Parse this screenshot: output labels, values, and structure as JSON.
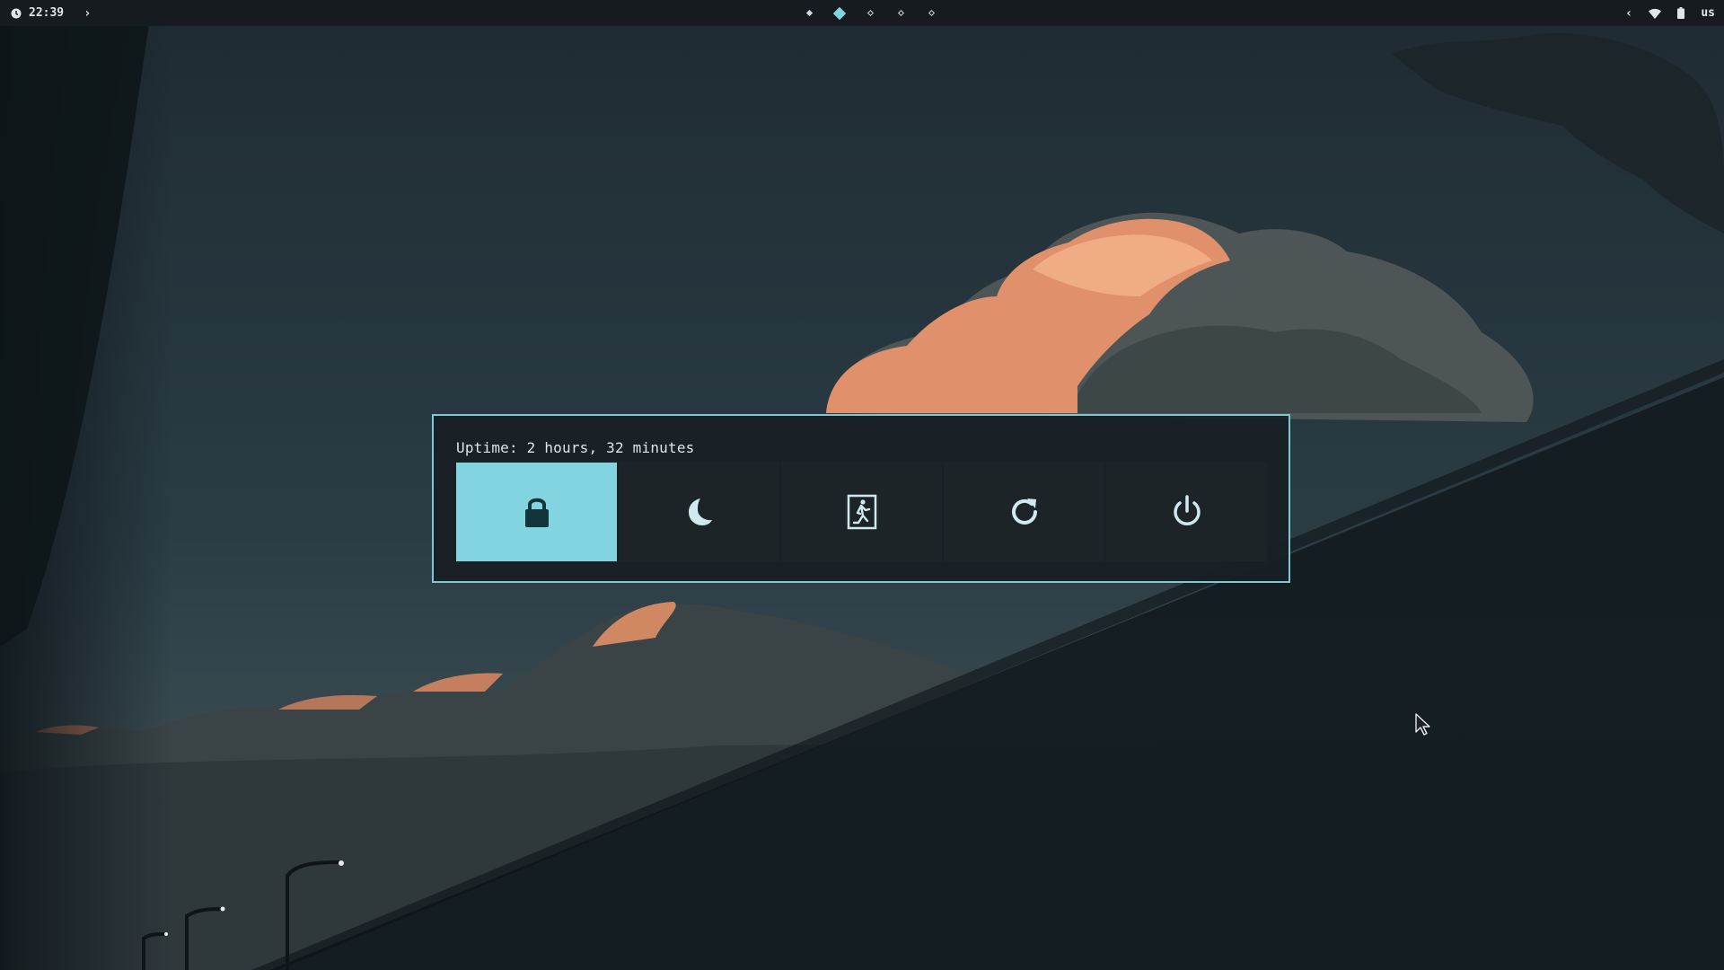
{
  "topbar": {
    "clock": "22:39",
    "workspaces": [
      {
        "name": "workspace-1",
        "state": "occupied"
      },
      {
        "name": "workspace-2",
        "state": "active"
      },
      {
        "name": "workspace-3",
        "state": "empty"
      },
      {
        "name": "workspace-4",
        "state": "empty"
      },
      {
        "name": "workspace-5",
        "state": "empty"
      }
    ],
    "keyboard_layout": "us"
  },
  "power_menu": {
    "uptime": "Uptime: 2 hours, 32 minutes",
    "buttons": [
      {
        "icon": "lock-icon",
        "selected": true
      },
      {
        "icon": "moon-icon",
        "selected": false
      },
      {
        "icon": "logout-icon",
        "selected": false
      },
      {
        "icon": "restart-icon",
        "selected": false
      },
      {
        "icon": "power-icon",
        "selected": false
      }
    ]
  },
  "colors": {
    "accent": "#82d4e1",
    "bar_bg": "#151b1f",
    "menu_bg": "#182024",
    "button_bg": "#1c2428"
  }
}
